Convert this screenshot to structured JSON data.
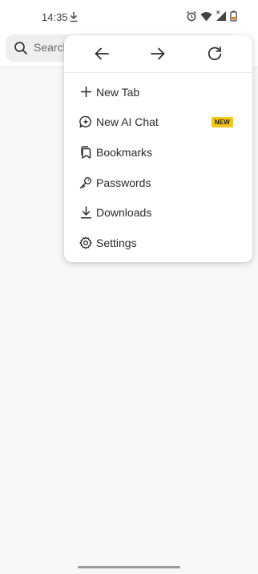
{
  "status_bar": {
    "time": "14:35"
  },
  "search": {
    "placeholder": "Search"
  },
  "menu": {
    "items": [
      {
        "label": "New Tab",
        "icon": "plus-icon"
      },
      {
        "label": "New AI Chat",
        "icon": "ai-chat-icon",
        "badge": "NEW"
      },
      {
        "label": "Bookmarks",
        "icon": "bookmarks-icon"
      },
      {
        "label": "Passwords",
        "icon": "key-icon"
      },
      {
        "label": "Downloads",
        "icon": "download-icon"
      },
      {
        "label": "Settings",
        "icon": "gear-icon"
      }
    ]
  },
  "colors": {
    "badge": "#f5c518",
    "background": "#f7f7f7",
    "menu": "#ffffff"
  }
}
